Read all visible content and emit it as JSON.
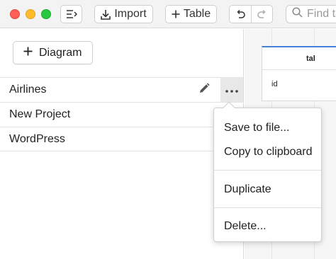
{
  "toolbar": {
    "import_label": "Import",
    "table_label": "Table",
    "search_placeholder": "Find tables"
  },
  "sidebar": {
    "add_diagram_label": "Diagram",
    "diagrams": [
      {
        "name": "Airlines",
        "selected": true
      },
      {
        "name": "New Project"
      },
      {
        "name": "WordPress"
      }
    ]
  },
  "context_menu": {
    "items": [
      "Save to file...",
      "Copy to clipboard",
      "Duplicate",
      "Delete..."
    ]
  },
  "canvas": {
    "table_name": "tal",
    "field_name": "id"
  },
  "colors": {
    "close": "#ff5f57",
    "minimize": "#febc2e",
    "zoom": "#28c840",
    "table_accent": "#4a7fd6"
  }
}
